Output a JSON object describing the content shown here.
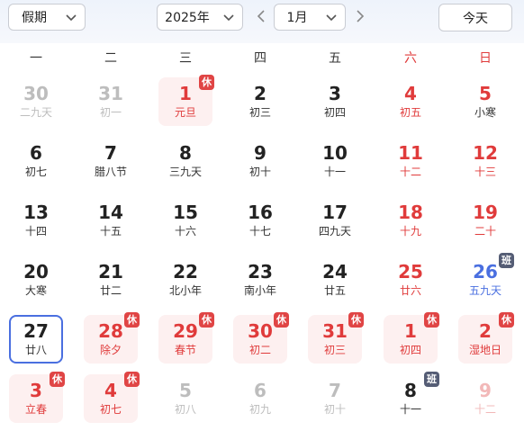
{
  "toolbar": {
    "holiday_select": "假期",
    "year_select": "2025年",
    "month_select": "1月",
    "today_button": "今天"
  },
  "weekdays": [
    "一",
    "二",
    "三",
    "四",
    "五",
    "六",
    "日"
  ],
  "badges": {
    "rest": "休",
    "work": "班"
  },
  "colors": {
    "holiday_red": "#e03b3b",
    "weekend_blue": "#4a6fe0",
    "rest_badge": "#e04545",
    "work_badge": "#555d75",
    "today_border": "#4a6fe0",
    "holiday_bg": "#fdf0f0"
  },
  "weeks": [
    [
      {
        "day": "30",
        "lunar": "二九天",
        "style": "dim"
      },
      {
        "day": "31",
        "lunar": "初一",
        "style": "dim"
      },
      {
        "day": "1",
        "lunar": "元旦",
        "style": "red",
        "bg": "holiday",
        "badge": "rest"
      },
      {
        "day": "2",
        "lunar": "初三",
        "style": "normal"
      },
      {
        "day": "3",
        "lunar": "初四",
        "style": "normal"
      },
      {
        "day": "4",
        "lunar": "初五",
        "style": "red"
      },
      {
        "day": "5",
        "lunar": "小寒",
        "style": "red",
        "lunar_style": "dark"
      }
    ],
    [
      {
        "day": "6",
        "lunar": "初七",
        "style": "normal"
      },
      {
        "day": "7",
        "lunar": "腊八节",
        "style": "normal"
      },
      {
        "day": "8",
        "lunar": "三九天",
        "style": "normal"
      },
      {
        "day": "9",
        "lunar": "初十",
        "style": "normal"
      },
      {
        "day": "10",
        "lunar": "十一",
        "style": "normal"
      },
      {
        "day": "11",
        "lunar": "十二",
        "style": "red"
      },
      {
        "day": "12",
        "lunar": "十三",
        "style": "red"
      }
    ],
    [
      {
        "day": "13",
        "lunar": "十四",
        "style": "normal"
      },
      {
        "day": "14",
        "lunar": "十五",
        "style": "normal"
      },
      {
        "day": "15",
        "lunar": "十六",
        "style": "normal"
      },
      {
        "day": "16",
        "lunar": "十七",
        "style": "normal"
      },
      {
        "day": "17",
        "lunar": "四九天",
        "style": "normal"
      },
      {
        "day": "18",
        "lunar": "十九",
        "style": "red"
      },
      {
        "day": "19",
        "lunar": "二十",
        "style": "red"
      }
    ],
    [
      {
        "day": "20",
        "lunar": "大寒",
        "style": "normal"
      },
      {
        "day": "21",
        "lunar": "廿二",
        "style": "normal"
      },
      {
        "day": "22",
        "lunar": "北小年",
        "style": "normal"
      },
      {
        "day": "23",
        "lunar": "南小年",
        "style": "normal"
      },
      {
        "day": "24",
        "lunar": "廿五",
        "style": "normal"
      },
      {
        "day": "25",
        "lunar": "廿六",
        "style": "red"
      },
      {
        "day": "26",
        "lunar": "五九天",
        "style": "blue",
        "badge": "work"
      }
    ],
    [
      {
        "day": "27",
        "lunar": "廿八",
        "style": "normal",
        "today": true
      },
      {
        "day": "28",
        "lunar": "除夕",
        "style": "red",
        "bg": "holiday",
        "badge": "rest"
      },
      {
        "day": "29",
        "lunar": "春节",
        "style": "red",
        "bg": "holiday",
        "badge": "rest"
      },
      {
        "day": "30",
        "lunar": "初二",
        "style": "red",
        "bg": "holiday",
        "badge": "rest"
      },
      {
        "day": "31",
        "lunar": "初三",
        "style": "red",
        "bg": "holiday",
        "badge": "rest"
      },
      {
        "day": "1",
        "lunar": "初四",
        "style": "red",
        "bg": "holiday",
        "badge": "rest"
      },
      {
        "day": "2",
        "lunar": "湿地日",
        "style": "red",
        "bg": "holiday",
        "badge": "rest"
      }
    ],
    [
      {
        "day": "3",
        "lunar": "立春",
        "style": "red",
        "bg": "holiday",
        "badge": "rest"
      },
      {
        "day": "4",
        "lunar": "初七",
        "style": "red",
        "bg": "holiday",
        "badge": "rest"
      },
      {
        "day": "5",
        "lunar": "初八",
        "style": "dim"
      },
      {
        "day": "6",
        "lunar": "初九",
        "style": "dim"
      },
      {
        "day": "7",
        "lunar": "初十",
        "style": "dim"
      },
      {
        "day": "8",
        "lunar": "十一",
        "style": "normal",
        "badge": "work"
      },
      {
        "day": "9",
        "lunar": "十二",
        "style": "dimred"
      }
    ]
  ]
}
